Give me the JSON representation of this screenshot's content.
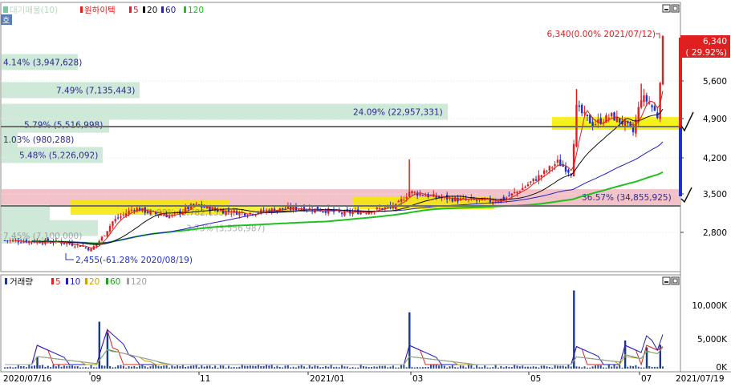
{
  "legend": {
    "volume_profile_label": "대기매물(10)",
    "stock_name": "원하이텍",
    "ma_items": [
      {
        "label": "5",
        "color": "#e02020"
      },
      {
        "label": "20",
        "color": "#111111"
      },
      {
        "label": "60",
        "color": "#2020c0"
      },
      {
        "label": "120",
        "color": "#20c020"
      }
    ],
    "side_tab": "호"
  },
  "volume_legend": {
    "title": "거래량",
    "items": [
      {
        "label": "5",
        "color": "#e02020"
      },
      {
        "label": "10",
        "color": "#2020c0"
      },
      {
        "label": "20",
        "color": "#c8a000"
      },
      {
        "label": "60",
        "color": "#20a020"
      },
      {
        "label": "120",
        "color": "#a0a0a0"
      }
    ]
  },
  "chart_data": [
    {
      "type": "candlestick",
      "y_ticks": [
        "5,600",
        "4,900",
        "4,200",
        "3,500",
        "2,800"
      ],
      "ylim": [
        2100,
        6600
      ],
      "last_price_label": "6,340",
      "last_change_label": "( 29.92%)",
      "high_annotation": "6,340(0.00% 2021/07/12)",
      "low_annotation": "2,455(-61.28% 2020/08/19)",
      "volume_profile": [
        {
          "label": "4.14% (3,947,628)",
          "price": 5950
        },
        {
          "label": "7.49% (7,135,443)",
          "price": 5430
        },
        {
          "label": "24.09% (22,957,331)",
          "price": 5030
        },
        {
          "label": "5.79% (5,516,998)",
          "price": 4790
        },
        {
          "label": "1.03% (980,288)",
          "price": 4520
        },
        {
          "label": "5.48% (5,226,092)",
          "price": 4230
        },
        {
          "label": "36.57% (34,855,925)",
          "price": 3450
        },
        {
          "label": "1.88% (1,782,153)",
          "price": 3170
        },
        {
          "label": "3.73% (3,556,987)",
          "price": 2880
        },
        {
          "label": "7.45% (7,100,000)",
          "price": 2740
        }
      ],
      "support_lines": [
        4750,
        3280
      ],
      "ma_levels": {
        "ma20_last": 4880,
        "ma60_last": 4480,
        "ma120_last": 4000
      }
    },
    {
      "type": "bar",
      "title": "거래량",
      "y_ticks": [
        "10,000K",
        "5,000K",
        "0K"
      ],
      "ylim": [
        0,
        13000
      ],
      "spikes": [
        {
          "date": "2020/08/24",
          "value": 1800
        },
        {
          "date": "2020/09/07",
          "value": 7500
        },
        {
          "date": "2020/09/10",
          "value": 5800
        },
        {
          "date": "2021/01/25",
          "value": 9000
        },
        {
          "date": "2021/05/12",
          "value": 12500
        },
        {
          "date": "2021/06/24",
          "value": 4500
        },
        {
          "date": "2021/07/07",
          "value": 3400
        },
        {
          "date": "2021/07/16",
          "value": 3800
        }
      ]
    }
  ],
  "x_axis": {
    "labels": [
      "2020/07/16",
      "09",
      "11",
      "2021/01",
      "03",
      "05",
      "07",
      "2021/07/19"
    ]
  }
}
